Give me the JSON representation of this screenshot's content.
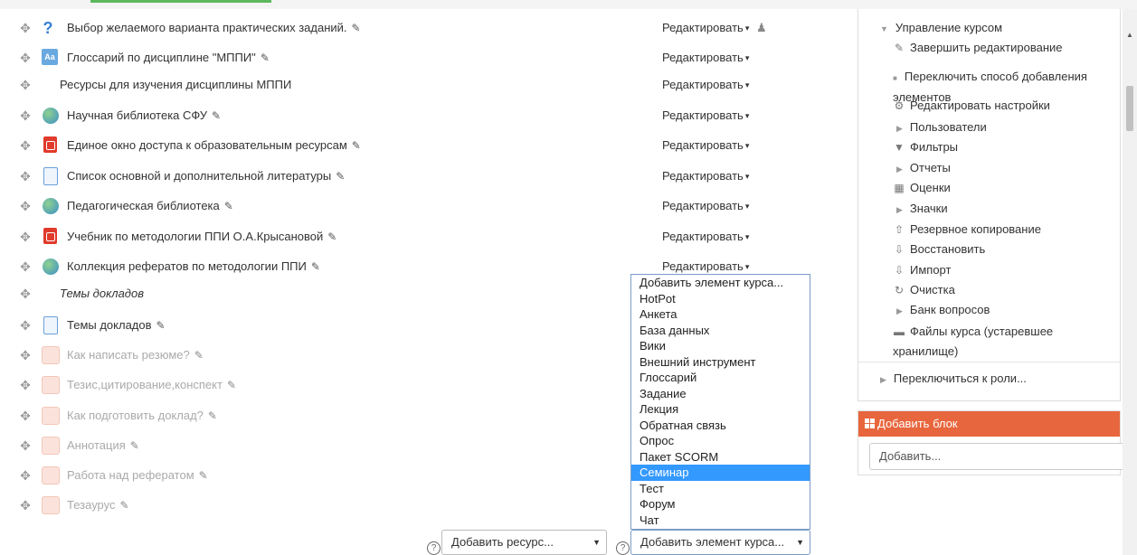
{
  "activities": [
    {
      "icon": "choice-icon",
      "name": "Выбор желаемого варианта практических заданий.",
      "edit": "Редактировать",
      "pencil": true,
      "dim": false,
      "style": "normal",
      "extra_icon": true
    },
    {
      "icon": "glossary-icon",
      "name": "Глоссарий по дисциплине \"МППИ\"",
      "edit": "Редактировать",
      "pencil": true,
      "dim": false,
      "style": "normal"
    },
    {
      "icon": "",
      "name": "Ресурсы для изучения дисциплины МППИ",
      "edit": "Редактировать",
      "pencil": false,
      "dim": false,
      "style": "plain"
    },
    {
      "icon": "url-icon",
      "name": "Научная библиотека СФУ",
      "edit": "Редактировать",
      "pencil": true,
      "dim": false,
      "style": "normal"
    },
    {
      "icon": "pdf-icon",
      "name": "Единое окно доступа к образовательным ресурсам",
      "edit": "Редактировать",
      "pencil": true,
      "dim": false,
      "style": "normal"
    },
    {
      "icon": "page-icon",
      "name": "Список основной и дополнительной литературы",
      "edit": "Редактировать",
      "pencil": true,
      "dim": false,
      "style": "normal"
    },
    {
      "icon": "url-icon",
      "name": "Педагогическая библиотека",
      "edit": "Редактировать",
      "pencil": true,
      "dim": false,
      "style": "normal"
    },
    {
      "icon": "pdf-icon",
      "name": "Учебник по методологии ППИ О.А.Крысановой",
      "edit": "Редактировать",
      "pencil": true,
      "dim": false,
      "style": "normal"
    },
    {
      "icon": "url-icon",
      "name": "Коллекция рефератов по методологии ППИ",
      "edit": "Редактировать",
      "pencil": true,
      "dim": false,
      "style": "normal"
    },
    {
      "icon": "",
      "name": "Темы докладов",
      "edit": "",
      "pencil": false,
      "dim": false,
      "style": "italic"
    },
    {
      "icon": "page-icon",
      "name": "Темы докладов",
      "edit": "",
      "pencil": true,
      "dim": false,
      "style": "normal"
    },
    {
      "icon": "faded-icon",
      "name": "Как написать резюме?",
      "edit": "",
      "pencil": true,
      "dim": true,
      "style": "normal"
    },
    {
      "icon": "faded-icon",
      "name": "Тезис,цитирование,конспект",
      "edit": "",
      "pencil": true,
      "dim": true,
      "style": "normal"
    },
    {
      "icon": "faded-icon",
      "name": "Как подготовить доклад?",
      "edit": "",
      "pencil": true,
      "dim": true,
      "style": "normal"
    },
    {
      "icon": "faded-icon",
      "name": "Аннотация",
      "edit": "",
      "pencil": true,
      "dim": true,
      "style": "normal"
    },
    {
      "icon": "faded-icon",
      "name": "Работа над рефератом",
      "edit": "",
      "pencil": true,
      "dim": true,
      "style": "normal"
    },
    {
      "icon": "faded-icon",
      "name": "Тезаурус",
      "edit": "",
      "pencil": true,
      "dim": true,
      "style": "normal"
    }
  ],
  "dropdown": {
    "options": [
      "Добавить элемент курса...",
      "HotPot",
      "Анкета",
      "База данных",
      "Вики",
      "Внешний инструмент",
      "Глоссарий",
      "Задание",
      "Лекция",
      "Обратная связь",
      "Опрос",
      "Пакет SCORM",
      "Семинар",
      "Тест",
      "Форум",
      "Чат"
    ],
    "selected": "Семинар"
  },
  "bottom": {
    "help_glyph": "?",
    "add_resource": "Добавить ресурс...",
    "add_activity": "Добавить элемент курса..."
  },
  "admin": {
    "title": "Управление курсом",
    "items": [
      {
        "kind": "pencil",
        "label": "Завершить редактирование"
      },
      {
        "kind": "dot",
        "label": "Переключить способ добавления элементов"
      },
      {
        "kind": "gear",
        "label": "Редактировать настройки"
      },
      {
        "kind": "tri",
        "label": "Пользователи"
      },
      {
        "kind": "filter",
        "label": "Фильтры"
      },
      {
        "kind": "tri",
        "label": "Отчеты"
      },
      {
        "kind": "table",
        "label": "Оценки"
      },
      {
        "kind": "tri",
        "label": "Значки"
      },
      {
        "kind": "upload",
        "label": "Резервное копирование"
      },
      {
        "kind": "download",
        "label": "Восстановить"
      },
      {
        "kind": "download",
        "label": "Импорт"
      },
      {
        "kind": "reset",
        "label": "Очистка"
      },
      {
        "kind": "tri",
        "label": "Банк вопросов"
      },
      {
        "kind": "folder",
        "label": "Файлы курса (устаревшее хранилище)"
      }
    ],
    "switch_role": "Переключиться к роли..."
  },
  "add_block": {
    "title": "Добавить блок",
    "select": "Добавить..."
  },
  "colors": {
    "accent": "#e8663d",
    "selected": "#3399ff",
    "progress": "#5cb85c"
  }
}
